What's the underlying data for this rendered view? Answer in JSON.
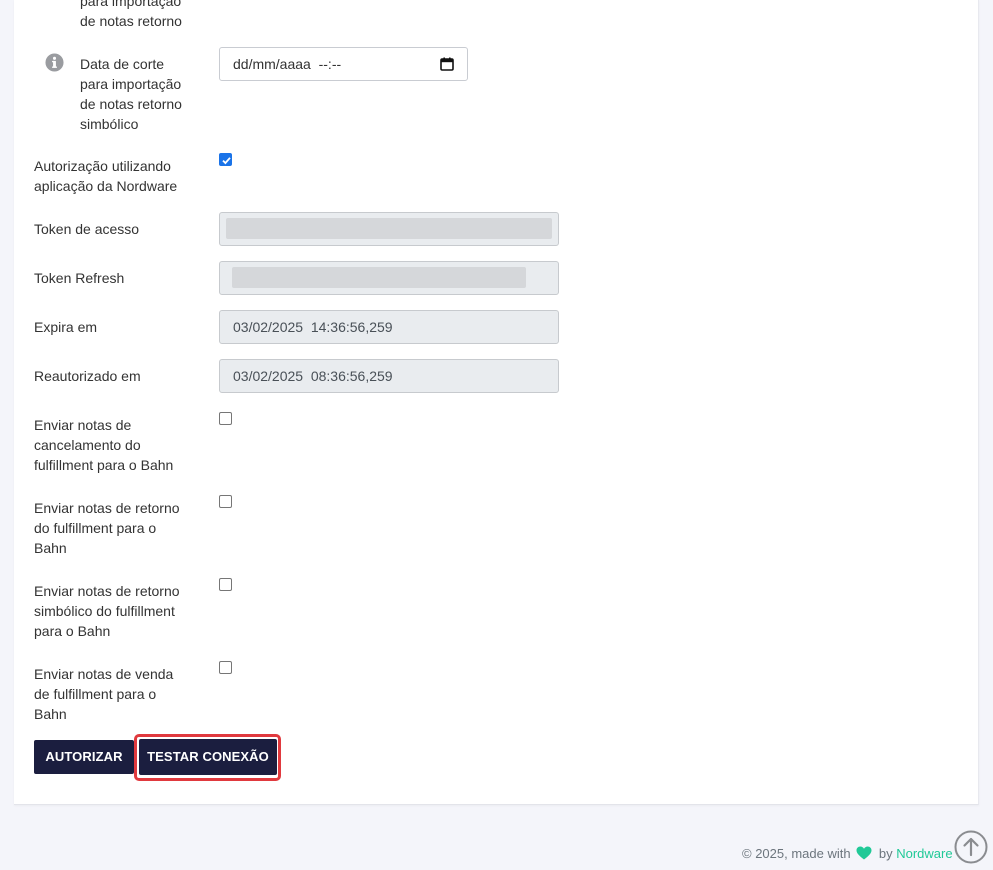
{
  "form": {
    "cut_partial_label": "para importação\nde notas retorno",
    "cut_symbolic_label": "Data de corte\npara importação\nde notas retorno\nsimbólico",
    "cut_symbolic_placeholder": "dd/mm/aaaa  --:--",
    "nordware_auth_label": "Autorização utilizando\naplicação da Nordware",
    "nordware_auth_checked": true,
    "access_token_label": "Token de acesso",
    "refresh_token_label": "Token Refresh",
    "expires_label": "Expira em",
    "expires_value": "03/02/2025  14:36:56,259",
    "reauthorized_label": "Reautorizado em",
    "reauthorized_value": "03/02/2025  08:36:56,259",
    "send_cancel_label": "Enviar notas de\ncancelamento do\nfulfillment para o Bahn",
    "send_return_label": "Enviar notas de retorno\ndo fulfillment para o\nBahn",
    "send_symbolic_return_label": "Enviar notas de retorno\nsimbólico do fulfillment\npara o Bahn",
    "send_sale_label": "Enviar notas de venda\nde fulfillment para o\nBahn"
  },
  "buttons": {
    "authorize": "AUTORIZAR",
    "test_connection": "TESTAR CONEXÃO"
  },
  "footer": {
    "prefix": "© 2025, made with",
    "by": "by",
    "brand": "Nordware"
  },
  "icons": {
    "info": "info-icon",
    "calendar": "calendar-icon",
    "heart": "heart-icon",
    "scroll_top": "arrow-up-circle-icon"
  },
  "colors": {
    "primary_button": "#1b1e3f",
    "highlight": "#e0393e",
    "brand": "#20c997",
    "checkbox_checked": "#1a73e8"
  }
}
